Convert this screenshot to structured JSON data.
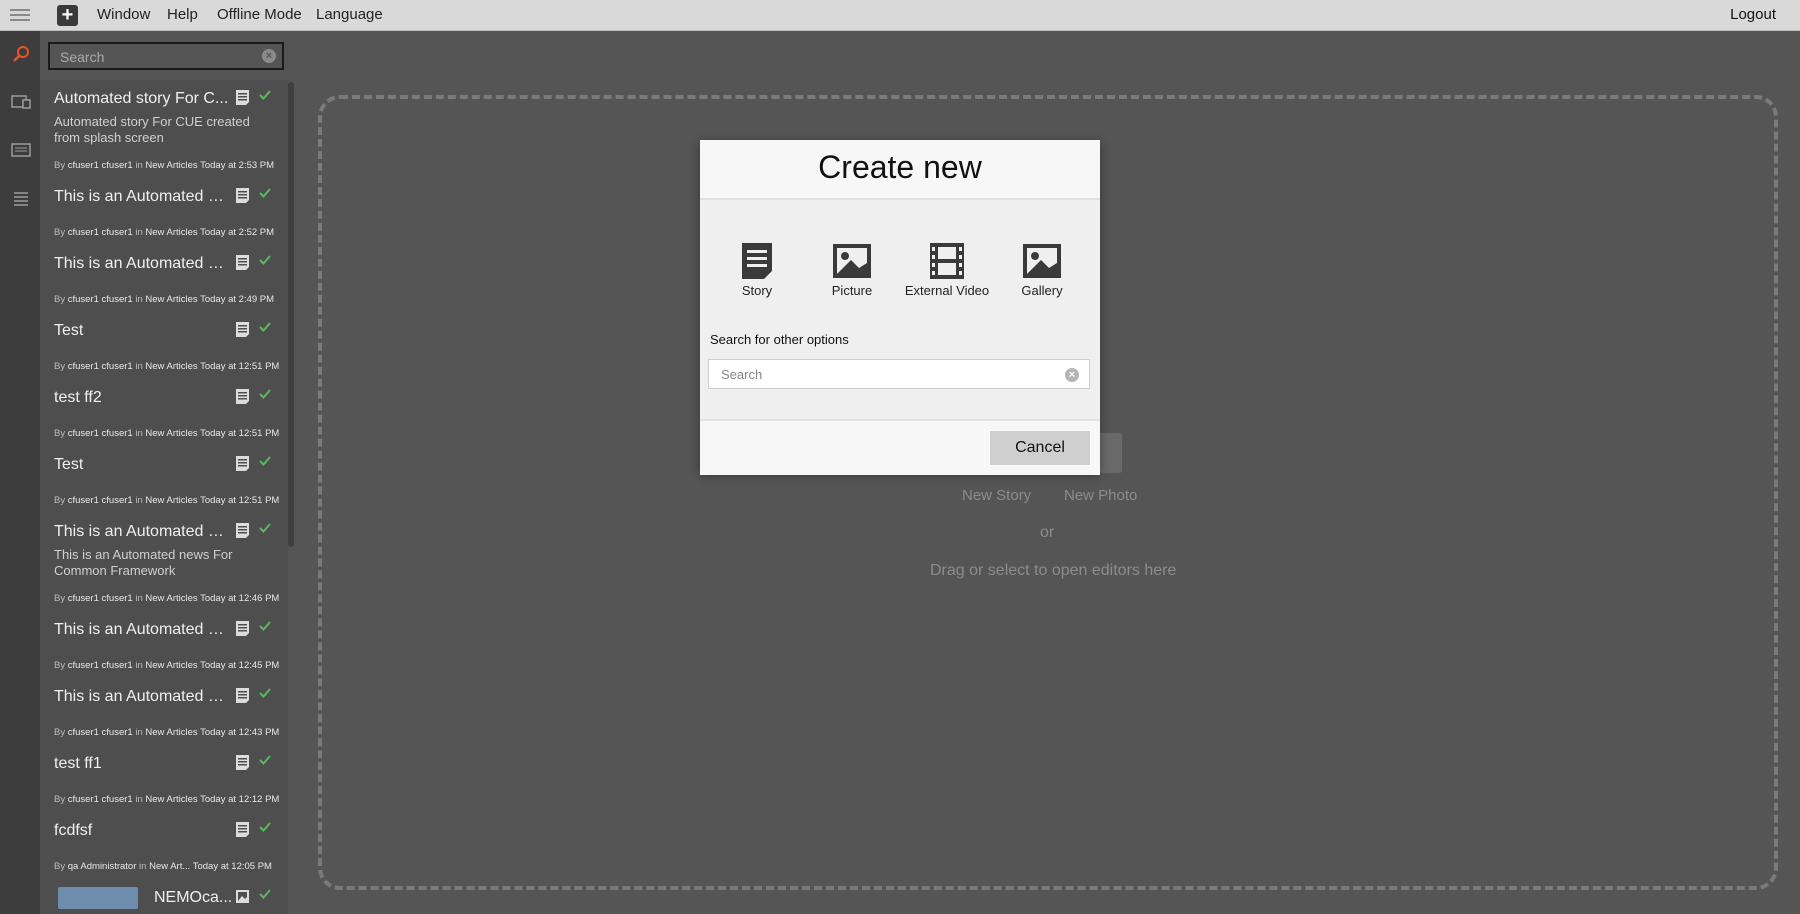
{
  "menubar": {
    "items": [
      "Window",
      "Help",
      "Offline Mode",
      "Language"
    ],
    "logout": "Logout"
  },
  "sidebar_search": {
    "placeholder": "Search"
  },
  "articles": [
    {
      "title": "Automated story For C...",
      "desc": "Automated story For CUE created from splash screen",
      "by": "cfuser1 cfuser1",
      "section": "New Articles",
      "time": "Today at 2:53 PM"
    },
    {
      "title": "This is an Automated st...",
      "desc": "",
      "by": "cfuser1 cfuser1",
      "section": "New Articles",
      "time": "Today at 2:52 PM"
    },
    {
      "title": "This is an Automated st...",
      "desc": "",
      "by": "cfuser1 cfuser1",
      "section": "New Articles",
      "time": "Today at 2:49 PM"
    },
    {
      "title": "Test",
      "desc": "",
      "by": "cfuser1 cfuser1",
      "section": "New Articles",
      "time": "Today at 12:51 PM"
    },
    {
      "title": "test ff2",
      "desc": "",
      "by": "cfuser1 cfuser1",
      "section": "New Articles",
      "time": "Today at 12:51 PM"
    },
    {
      "title": "Test",
      "desc": "",
      "by": "cfuser1 cfuser1",
      "section": "New Articles",
      "time": "Today at 12:51 PM"
    },
    {
      "title": "This is an Automated ne...",
      "desc": "This is an Automated news For Common Framework",
      "by": "cfuser1 cfuser1",
      "section": "New Articles",
      "time": "Today at 12:46 PM"
    },
    {
      "title": "This is an Automated st...",
      "desc": "",
      "by": "cfuser1 cfuser1",
      "section": "New Articles",
      "time": "Today at 12:45 PM"
    },
    {
      "title": "This is an Automated st...",
      "desc": "",
      "by": "cfuser1 cfuser1",
      "section": "New Articles",
      "time": "Today at 12:43 PM"
    },
    {
      "title": "test ff1",
      "desc": "",
      "by": "cfuser1 cfuser1",
      "section": "New Articles",
      "time": "Today at 12:12 PM"
    },
    {
      "title": "fcdfsf",
      "desc": "",
      "by": "qa Administrator",
      "section": "New Art...",
      "time": "Today at 12:05 PM"
    },
    {
      "title": "NEMOca...",
      "desc": "",
      "by": "",
      "section": "",
      "time": ""
    }
  ],
  "byword": "By",
  "inword": "in",
  "dropzone": {
    "new_story": "New Story",
    "new_photo": "New Photo",
    "or": "or",
    "drag": "Drag or select to open editors here"
  },
  "modal": {
    "title": "Create new",
    "options": [
      "Story",
      "Picture",
      "External Video",
      "Gallery"
    ],
    "other_label": "Search for other options",
    "search_placeholder": "Search",
    "cancel": "Cancel"
  },
  "colors": {
    "check": "#5cb85c",
    "accent_search_icon": "#e8542a"
  }
}
